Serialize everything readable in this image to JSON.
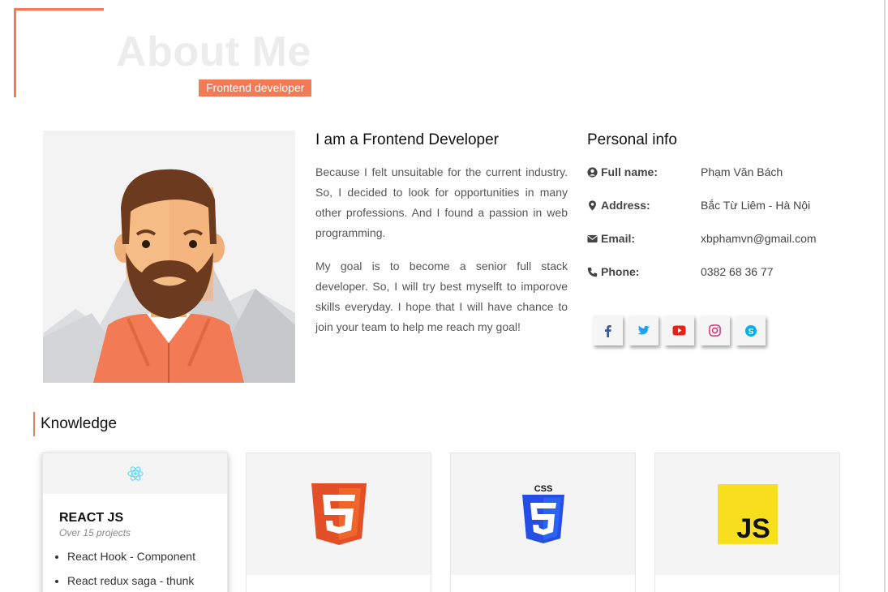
{
  "header": {
    "title": "About Me",
    "subtitle": "Frontend developer"
  },
  "intro": {
    "heading": "I am a Frontend Developer",
    "paragraphs": [
      "Because I felt unsuitable for the current industry. So, I decided to look for opportunities in many other professions. And I found a passion in web programming.",
      "My goal is to become a senior full stack developer. So, I will try best myselft to imporove skills everyday. I hope that I will have chance to join your team to help me reach my goal!"
    ]
  },
  "personal_info": {
    "heading": "Personal info",
    "rows": [
      {
        "icon": "user-circle-icon",
        "label": "Full name:",
        "value": "Phạm Văn Bách"
      },
      {
        "icon": "map-marker-icon",
        "label": "Address:",
        "value": "Bắc Từ Liêm - Hà Nội"
      },
      {
        "icon": "envelope-icon",
        "label": "Email:",
        "value": "xbphamvn@gmail.com"
      },
      {
        "icon": "phone-icon",
        "label": "Phone:",
        "value": "0382 68 36 77"
      }
    ],
    "socials": [
      {
        "icon": "facebook-icon",
        "color": "#3b5998"
      },
      {
        "icon": "twitter-icon",
        "color": "#1da1f2"
      },
      {
        "icon": "youtube-icon",
        "color": "#e62117"
      },
      {
        "icon": "instagram-icon",
        "color": "#e1306c"
      },
      {
        "icon": "skype-icon",
        "color": "#00aff0"
      }
    ]
  },
  "knowledge": {
    "heading": "Knowledge",
    "cards": [
      {
        "icon": "react-icon",
        "title": "REACT JS",
        "subtitle": "Over 15 projects",
        "items": [
          "React Hook - Component",
          "React redux saga - thunk"
        ]
      },
      {
        "icon": "html5-icon"
      },
      {
        "icon": "css3-icon"
      },
      {
        "icon": "javascript-icon"
      }
    ]
  },
  "colors": {
    "accent": "#f27a54",
    "title_watermark": "#ececec"
  }
}
